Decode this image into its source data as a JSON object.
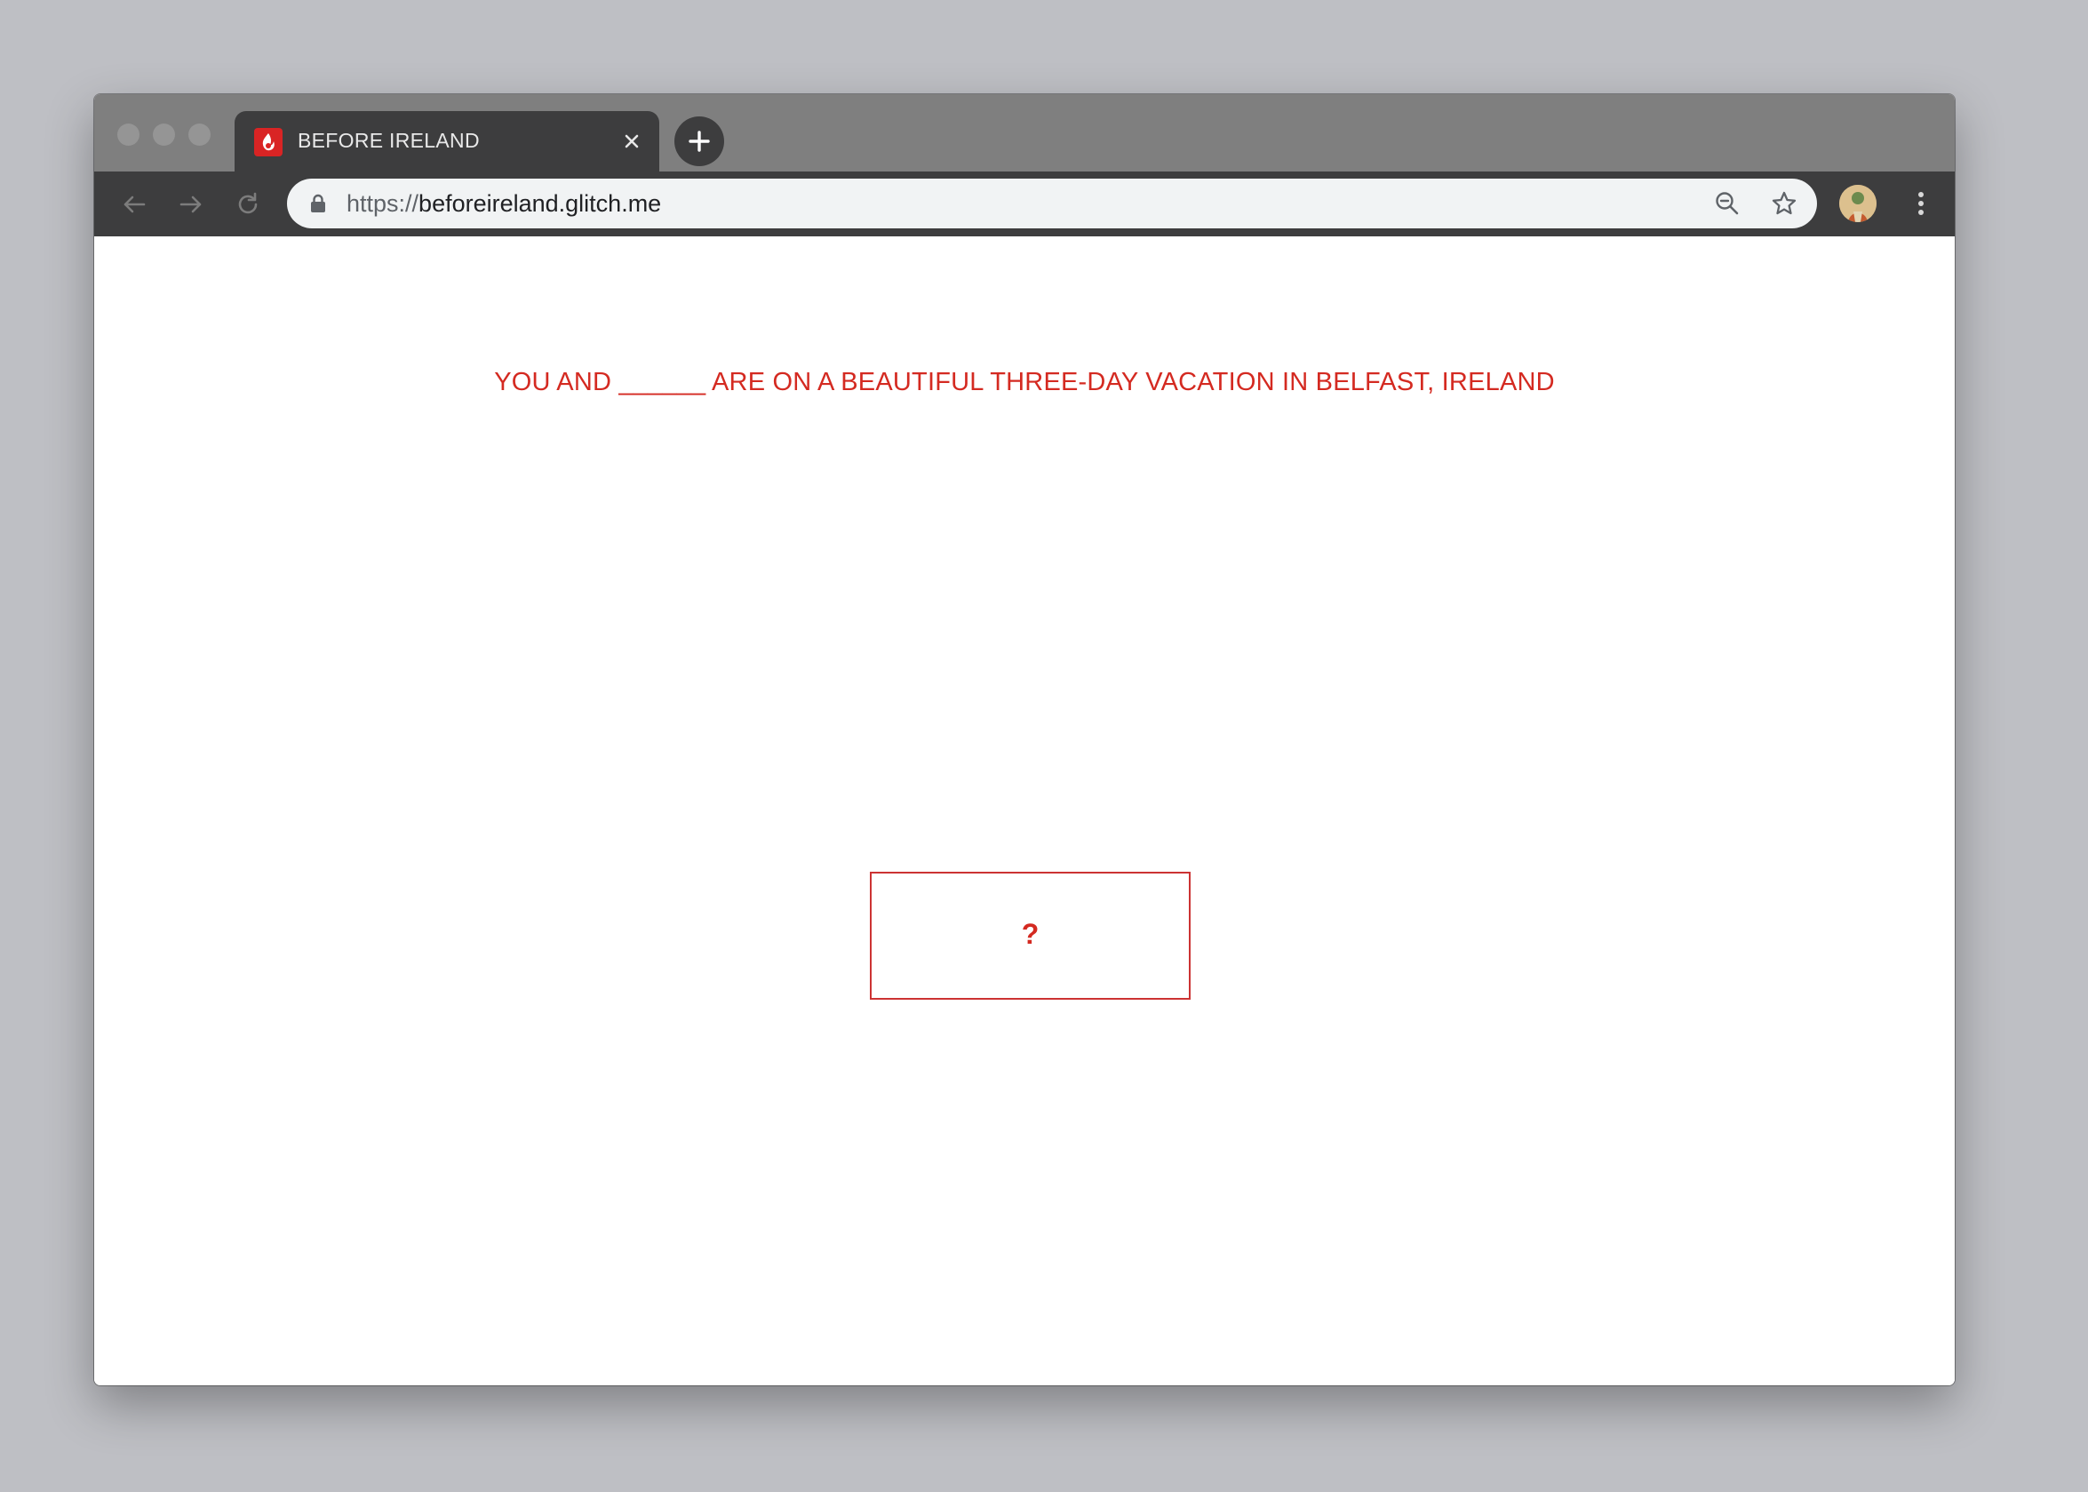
{
  "browser": {
    "tab": {
      "title": "BEFORE IRELAND",
      "favicon": "flame-favicon-icon"
    },
    "address_bar": {
      "scheme": "https://",
      "host": "beforeireland.glitch.me"
    },
    "icons": {
      "back": "back-arrow-icon",
      "forward": "forward-arrow-icon",
      "reload": "reload-icon",
      "zoom": "zoom-out-icon",
      "bookmark": "star-icon",
      "profile": "avatar",
      "menu": "kebab-menu-icon",
      "new_tab": "plus-icon",
      "close_tab": "close-icon"
    }
  },
  "page": {
    "headline": "YOU AND ______ ARE ON A BEAUTIFUL THREE-DAY VACATION IN BELFAST, IRELAND",
    "answer_button": "?"
  },
  "colors": {
    "accent_red": "#d42a21",
    "box_border": "#cc3333",
    "tab_dark": "#3d3d3e",
    "titlebar": "#7f7f7f",
    "desktop": "#bebfc4"
  }
}
